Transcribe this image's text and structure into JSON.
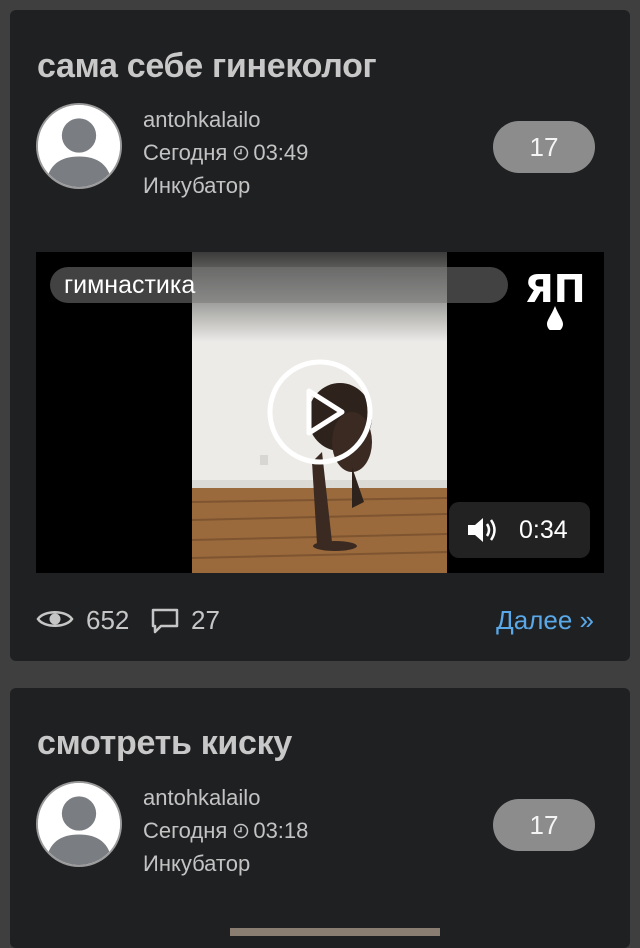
{
  "posts": [
    {
      "title": "сама себе гинеколог",
      "author": "antohkalailo",
      "date": "Сегодня",
      "time": "03:49",
      "category": "Инкубатор",
      "rating": "17",
      "video": {
        "title": "гимнастика",
        "duration": "0:34",
        "logo": "ЯП"
      },
      "views": "652",
      "comments": "27",
      "more_label": "Далее »"
    },
    {
      "title": "смотреть киску",
      "author": "antohkalailo",
      "date": "Сегодня",
      "time": "03:18",
      "category": "Инкубатор",
      "rating": "17"
    }
  ],
  "icons": {
    "clock": "clock-icon",
    "eye": "eye-icon",
    "comment": "comment-icon",
    "play": "play-icon",
    "sound": "speaker-icon",
    "avatar": "user-silhouette-icon"
  },
  "colors": {
    "link": "#5aa8e8",
    "card_bg": "#1f2022",
    "page_bg": "#3f3f3f",
    "rating_bg": "#8c8c8c"
  }
}
